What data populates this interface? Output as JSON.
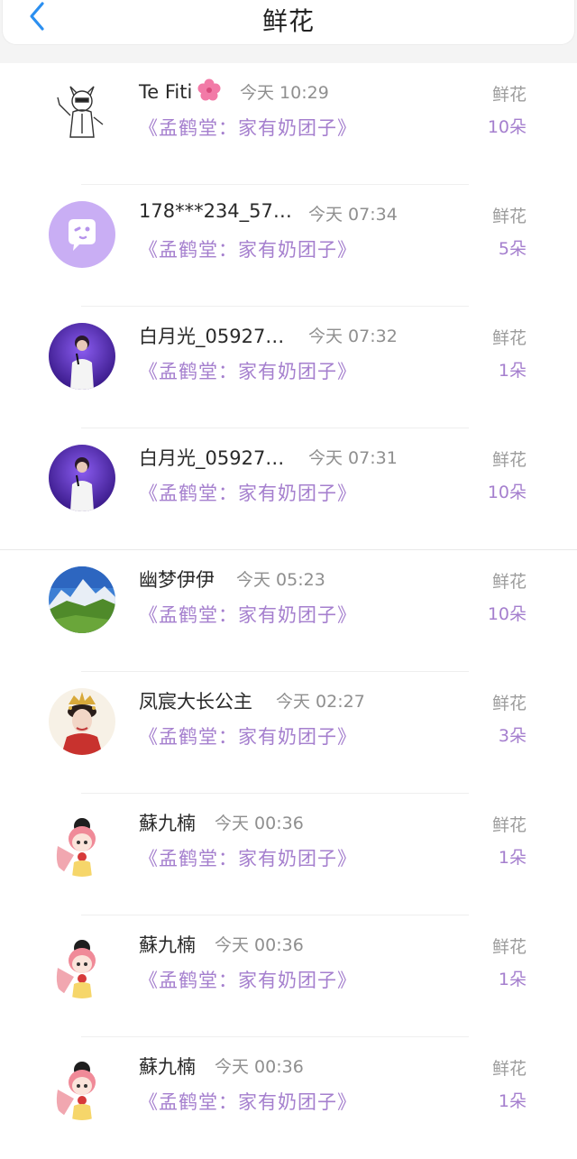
{
  "header": {
    "title": "鲜花",
    "back_icon": "chevron-left-icon",
    "accent": "#2b8ff0"
  },
  "colors": {
    "purple": "#a57fce",
    "gray_text": "#8f8f8f"
  },
  "rows": [
    {
      "name": "Te Fiti",
      "emoji": "hibiscus-flower-icon",
      "time": "今天 10:29",
      "book": "《孟鹤堂：家有奶团子》",
      "kind": "鲜花",
      "count": "10朵",
      "avatar": "sketch-character-avatar"
    },
    {
      "name": "178***234_57…",
      "time": "今天 07:34",
      "book": "《孟鹤堂：家有奶团子》",
      "kind": "鲜花",
      "count": "5朵",
      "avatar": "default-chat-avatar"
    },
    {
      "name": "白月光_05927…",
      "time": "今天 07:32",
      "book": "《孟鹤堂：家有奶团子》",
      "kind": "鲜花",
      "count": "1朵",
      "avatar": "singer-stage-avatar"
    },
    {
      "name": "白月光_05927…",
      "time": "今天 07:31",
      "book": "《孟鹤堂：家有奶团子》",
      "kind": "鲜花",
      "count": "10朵",
      "avatar": "singer-stage-avatar"
    },
    {
      "name": "幽梦伊伊",
      "time": "今天 05:23",
      "book": "《孟鹤堂：家有奶团子》",
      "kind": "鲜花",
      "count": "10朵",
      "avatar": "mountain-landscape-avatar"
    },
    {
      "name": "凤宸大长公主",
      "time": "今天 02:27",
      "book": "《孟鹤堂：家有奶团子》",
      "kind": "鲜花",
      "count": "3朵",
      "avatar": "princess-portrait-avatar"
    },
    {
      "name": "蘇九楠",
      "time": "今天 00:36",
      "book": "《孟鹤堂：家有奶团子》",
      "kind": "鲜花",
      "count": "1朵",
      "avatar": "anime-girl-avatar"
    },
    {
      "name": "蘇九楠",
      "time": "今天 00:36",
      "book": "《孟鹤堂：家有奶团子》",
      "kind": "鲜花",
      "count": "1朵",
      "avatar": "anime-girl-avatar"
    },
    {
      "name": "蘇九楠",
      "time": "今天 00:36",
      "book": "《孟鹤堂：家有奶团子》",
      "kind": "鲜花",
      "count": "1朵",
      "avatar": "anime-girl-avatar"
    }
  ]
}
